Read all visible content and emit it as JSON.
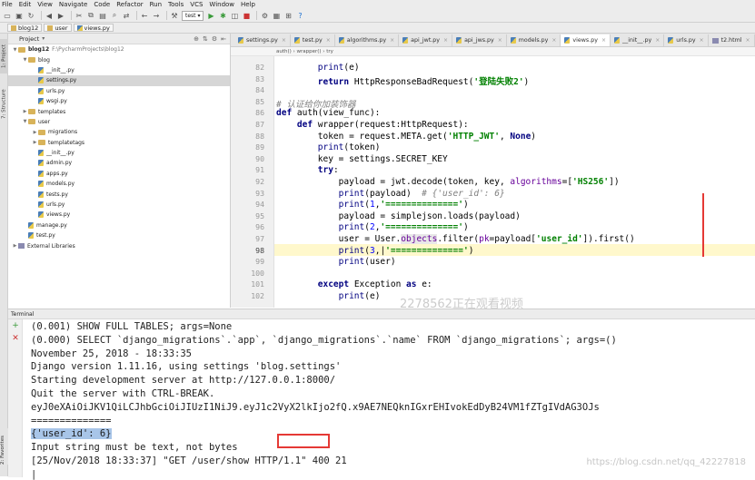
{
  "menu": [
    "File",
    "Edit",
    "View",
    "Navigate",
    "Code",
    "Refactor",
    "Run",
    "Tools",
    "VCS",
    "Window",
    "Help"
  ],
  "toolbar": {
    "run_config": "test"
  },
  "breadcrumb": [
    "blog12",
    "user",
    "views.py"
  ],
  "left_strip": {
    "project": "1: Project",
    "structure": "7: Structure",
    "favorites": "2: Favorites"
  },
  "project_panel": {
    "title": "Project",
    "tree": [
      {
        "label": "blog12",
        "path": "F:\\PycharmProjects\\blog12",
        "depth": 0,
        "kind": "folder",
        "arrow": "▼"
      },
      {
        "label": "blog",
        "depth": 1,
        "kind": "folder",
        "arrow": "▼"
      },
      {
        "label": "__init__.py",
        "depth": 2,
        "kind": "py",
        "arrow": ""
      },
      {
        "label": "settings.py",
        "depth": 2,
        "kind": "py",
        "arrow": "",
        "selected": true
      },
      {
        "label": "urls.py",
        "depth": 2,
        "kind": "py",
        "arrow": ""
      },
      {
        "label": "wsgi.py",
        "depth": 2,
        "kind": "py",
        "arrow": ""
      },
      {
        "label": "templates",
        "depth": 1,
        "kind": "folder",
        "arrow": "▶"
      },
      {
        "label": "user",
        "depth": 1,
        "kind": "folder",
        "arrow": "▼"
      },
      {
        "label": "migrations",
        "depth": 2,
        "kind": "folder",
        "arrow": "▶"
      },
      {
        "label": "templatetags",
        "depth": 2,
        "kind": "folder",
        "arrow": "▶"
      },
      {
        "label": "__init__.py",
        "depth": 2,
        "kind": "py",
        "arrow": ""
      },
      {
        "label": "admin.py",
        "depth": 2,
        "kind": "py",
        "arrow": ""
      },
      {
        "label": "apps.py",
        "depth": 2,
        "kind": "py",
        "arrow": ""
      },
      {
        "label": "models.py",
        "depth": 2,
        "kind": "py",
        "arrow": ""
      },
      {
        "label": "tests.py",
        "depth": 2,
        "kind": "py",
        "arrow": ""
      },
      {
        "label": "urls.py",
        "depth": 2,
        "kind": "py",
        "arrow": ""
      },
      {
        "label": "views.py",
        "depth": 2,
        "kind": "py",
        "arrow": ""
      },
      {
        "label": "manage.py",
        "depth": 1,
        "kind": "py",
        "arrow": ""
      },
      {
        "label": "test.py",
        "depth": 1,
        "kind": "py",
        "arrow": ""
      },
      {
        "label": "External Libraries",
        "depth": 0,
        "kind": "lib",
        "arrow": "▶"
      }
    ]
  },
  "editor": {
    "tabs": [
      {
        "label": "settings.py",
        "active": false
      },
      {
        "label": "test.py",
        "active": false
      },
      {
        "label": "algorithms.py",
        "active": false
      },
      {
        "label": "api_jwt.py",
        "active": false
      },
      {
        "label": "api_jws.py",
        "active": false
      },
      {
        "label": "models.py",
        "active": false
      },
      {
        "label": "views.py",
        "active": true
      },
      {
        "label": "__init__.py",
        "active": false
      },
      {
        "label": "urls.py",
        "active": false
      },
      {
        "label": "t2.html",
        "active": false
      }
    ],
    "code_breadcrumb": "auth()  ›  wrapper()  ›  try",
    "line_numbers": [
      "82",
      "83",
      "84",
      "85",
      "86",
      "87",
      "88",
      "89",
      "90",
      "91",
      "92",
      "93",
      "94",
      "95",
      "96",
      "97",
      "98",
      "99",
      "100",
      "101",
      "102"
    ],
    "current_line": "98"
  },
  "watermark": "2278562正在观看视频",
  "terminal": {
    "title": "Terminal",
    "lines": [
      "(0.001) SHOW FULL TABLES; args=None",
      "(0.000) SELECT `django_migrations`.`app`, `django_migrations`.`name` FROM `django_migrations`; args=()",
      "November 25, 2018 - 18:33:35",
      "Django version 1.11.16, using settings 'blog.settings'",
      "Starting development server at http://127.0.0.1:8000/",
      "Quit the server with CTRL-BREAK.",
      "eyJ0eXAiOiJKV1QiLCJhbGciOiJIUzI1NiJ9.eyJ1c2VyX2lkIjo2fQ.x9AE7NEQknIGxrEHIvokEdDyB24VM1fZTgIVdAG3OJs",
      "==============",
      "{'user_id': 6}",
      "Input string must be text, not bytes",
      "[25/Nov/2018 18:33:37] \"GET /user/show HTTP/1.1\" 400 21",
      ""
    ]
  },
  "csdn_watermark": "https://blog.csdn.net/qq_42227818"
}
